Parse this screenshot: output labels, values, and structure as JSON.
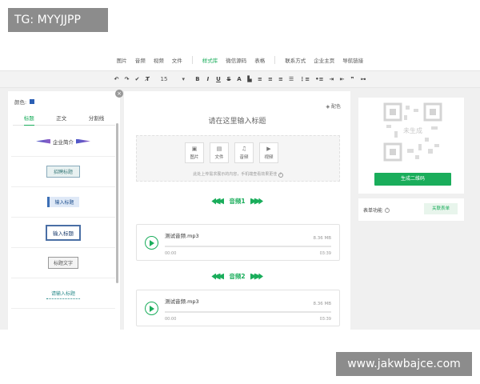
{
  "overlays": {
    "tag": "TG: MYYJJPP",
    "url": "www.jakwbajce.com"
  },
  "topnav": {
    "groups": [
      [
        "图片",
        "音频",
        "视频",
        "文件"
      ],
      [
        "样式库",
        "微信源码",
        "表格"
      ],
      [
        "联系方式",
        "企业主页",
        "导航链接"
      ]
    ],
    "active": "样式库"
  },
  "toolbar": {
    "font_size": "15",
    "buttons": [
      "undo-icon",
      "redo-icon",
      "format-brush-icon",
      "clear-format-icon",
      "bold-icon",
      "italic-icon",
      "underline-icon",
      "strikethrough-icon",
      "font-color-icon",
      "bg-color-icon",
      "align-left-icon",
      "align-center-icon",
      "align-right-icon",
      "justify-icon",
      "ordered-list-icon",
      "unordered-list-icon",
      "indent-icon",
      "outdent-icon",
      "quote-icon",
      "link-icon"
    ],
    "labels": {
      "B": "B",
      "I": "I",
      "U": "U",
      "S": "S",
      "A": "A"
    }
  },
  "left_panel": {
    "color_label": "颜色:",
    "color_value": "#2b5fb4",
    "close": "×",
    "tabs": [
      "标题",
      "正文",
      "分割线"
    ],
    "active_tab": "标题",
    "styles": [
      "企业简介",
      "招聘标题",
      "输入标题",
      "输入标题",
      "标题文字",
      "请输入标题"
    ]
  },
  "editor": {
    "color_button": "配色",
    "title_placeholder": "请在这里输入标题",
    "upload_buttons": [
      {
        "icon": "image-icon",
        "label": "图片"
      },
      {
        "icon": "file-icon",
        "label": "文件"
      },
      {
        "icon": "music-icon",
        "label": "音频"
      },
      {
        "icon": "video-icon",
        "label": "视频"
      }
    ],
    "upload_note": "此处上传需求展示的内容，手机端查看效果更佳",
    "audio_sections": [
      {
        "heading": "音频1",
        "file": "测试音频.mp3",
        "size": "8.36 MB",
        "start": "00:00",
        "end": "03:39"
      },
      {
        "heading": "音频2",
        "file": "测试音频.mp3",
        "size": "8.36 MB",
        "start": "00:00",
        "end": "03:39"
      }
    ]
  },
  "right_panel": {
    "qr_label": "未生成",
    "generate_button": "生成二维码",
    "form_label": "表单功能",
    "link_button": "关联表单"
  },
  "colors": {
    "accent": "#1aad5b",
    "workarea": "#f0f0f0"
  }
}
